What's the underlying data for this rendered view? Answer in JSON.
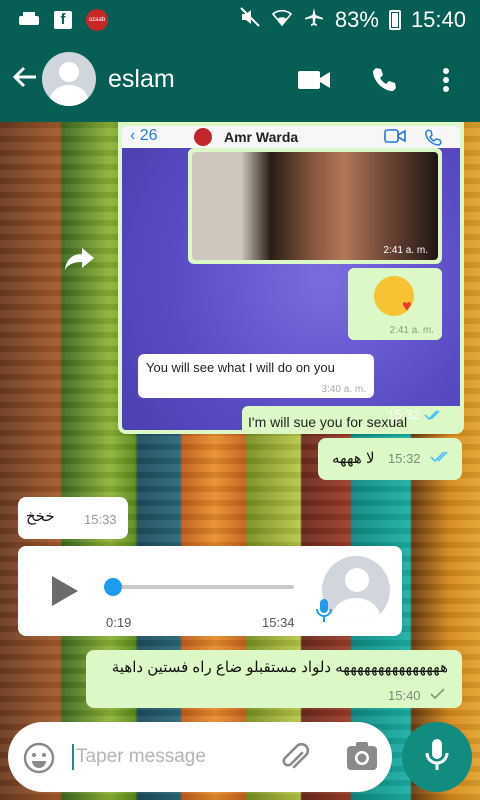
{
  "status_bar": {
    "battery": "83%",
    "time": "15:40",
    "app_badge": "ozaab"
  },
  "header": {
    "contact_name": "eslam"
  },
  "screenshot_message": {
    "back_count": "26",
    "contact_name": "Amr Warda",
    "photo_time": "2:41 a. m.",
    "kiss_time": "2:41 a. m.",
    "incoming_text": "You will see what I will do on you",
    "incoming_time": "3:40 a. m.",
    "outgoing_text": "I'm will sue you for sexual",
    "time": "15:32"
  },
  "messages": [
    {
      "text": "لا هههه",
      "time": "15:32"
    },
    {
      "text": "خخخ",
      "time": "15:33"
    },
    {
      "text": "هههههههههههههههه دلواد مستقبلو ضاع راه فستين داهية",
      "time": "15:40"
    }
  ],
  "voice_note": {
    "duration": "0:19",
    "time": "15:34",
    "progress": 0
  },
  "input": {
    "placeholder": "Taper message"
  },
  "colors": {
    "header": "#075e54",
    "outgoing_bubble": "#dcf8c6",
    "fab": "#128c7e"
  }
}
